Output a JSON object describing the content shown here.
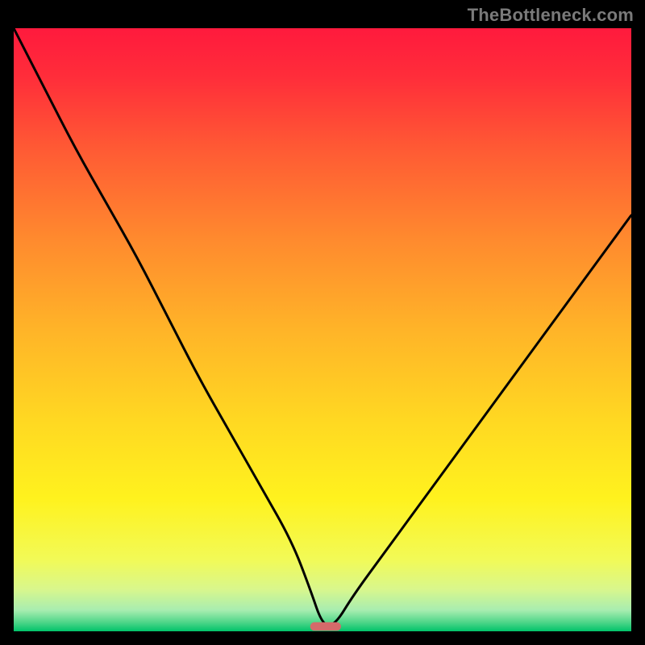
{
  "watermark": "TheBottleneck.com",
  "chart_data": {
    "type": "line",
    "title": "",
    "xlabel": "",
    "ylabel": "",
    "xlim": [
      0,
      100
    ],
    "ylim": [
      0,
      100
    ],
    "background_gradient_stops": [
      {
        "offset": 0.0,
        "color": "#ff1a3d"
      },
      {
        "offset": 0.08,
        "color": "#ff2d3a"
      },
      {
        "offset": 0.2,
        "color": "#ff5a34"
      },
      {
        "offset": 0.35,
        "color": "#ff8a2e"
      },
      {
        "offset": 0.5,
        "color": "#ffb428"
      },
      {
        "offset": 0.65,
        "color": "#ffd822"
      },
      {
        "offset": 0.78,
        "color": "#fff21e"
      },
      {
        "offset": 0.88,
        "color": "#f2fa56"
      },
      {
        "offset": 0.93,
        "color": "#d9f78c"
      },
      {
        "offset": 0.965,
        "color": "#a8edb0"
      },
      {
        "offset": 0.985,
        "color": "#4fd689"
      },
      {
        "offset": 1.0,
        "color": "#00c36a"
      }
    ],
    "series": [
      {
        "name": "bottleneck-curve",
        "color": "#000000",
        "x": [
          0,
          5,
          10,
          15,
          20,
          25,
          30,
          35,
          40,
          45,
          48,
          50,
          52,
          55,
          60,
          65,
          70,
          75,
          80,
          85,
          90,
          95,
          100
        ],
        "y": [
          100,
          90,
          80,
          71,
          62,
          52,
          42,
          33,
          24,
          15,
          7,
          1,
          1,
          6,
          13,
          20,
          27,
          34,
          41,
          48,
          55,
          62,
          69
        ]
      }
    ],
    "marker": {
      "name": "optimal-range",
      "color": "#d46a6a",
      "x": 50.5,
      "y": 0.8,
      "width_pct": 5.0,
      "height_pct": 1.4
    }
  }
}
